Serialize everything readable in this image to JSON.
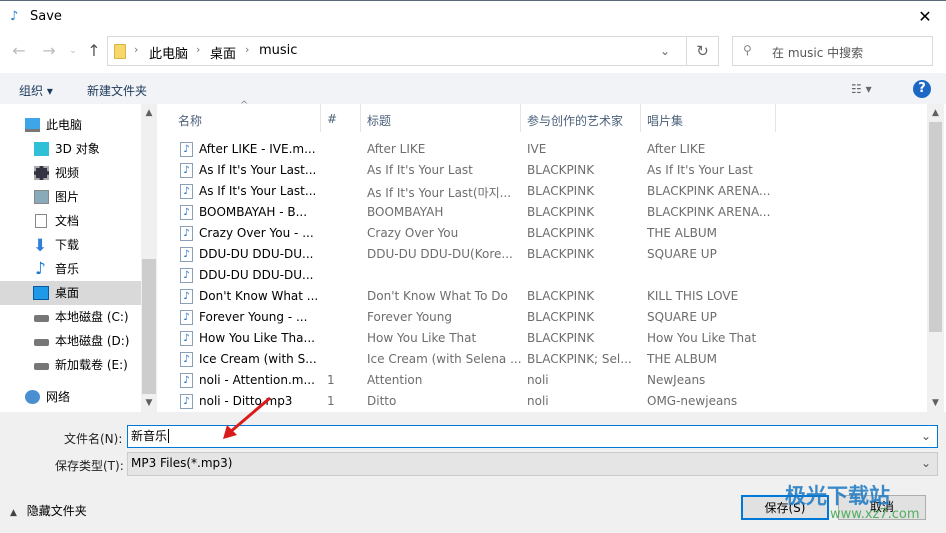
{
  "window": {
    "title": "Save",
    "close": "✕"
  },
  "address": {
    "crumbs": [
      "此电脑",
      "桌面",
      "music"
    ],
    "search_placeholder": "在 music 中搜索"
  },
  "toolbar": {
    "organize": "组织 ▾",
    "new_folder": "新建文件夹",
    "help": "?"
  },
  "sidebar": {
    "items": [
      {
        "label": "此电脑",
        "icon": "computer-icon"
      },
      {
        "label": "3D 对象",
        "icon": "cube-icon"
      },
      {
        "label": "视频",
        "icon": "video-icon"
      },
      {
        "label": "图片",
        "icon": "picture-icon"
      },
      {
        "label": "文档",
        "icon": "document-icon"
      },
      {
        "label": "下载",
        "icon": "download-icon"
      },
      {
        "label": "音乐",
        "icon": "music-icon"
      },
      {
        "label": "桌面",
        "icon": "desktop-icon",
        "selected": true
      },
      {
        "label": "本地磁盘 (C:)",
        "icon": "drive-icon"
      },
      {
        "label": "本地磁盘 (D:)",
        "icon": "drive-icon"
      },
      {
        "label": "新加载卷 (E:)",
        "icon": "drive-icon"
      },
      {
        "label": "网络",
        "icon": "network-icon"
      }
    ]
  },
  "columns": [
    "名称",
    "#",
    "标题",
    "参与创作的艺术家",
    "唱片集"
  ],
  "files": [
    {
      "name": "After LIKE - IVE.m...",
      "num": "",
      "title": "After LIKE",
      "artist": "IVE",
      "album": "After LIKE"
    },
    {
      "name": "As If It's Your Last...",
      "num": "",
      "title": "As If It's Your Last",
      "artist": "BLACKPINK",
      "album": "As If It's Your Last"
    },
    {
      "name": "As If It's Your Last...",
      "num": "",
      "title": "As If It's Your Last(마지...",
      "artist": "BLACKPINK",
      "album": "BLACKPINK ARENA..."
    },
    {
      "name": "BOOMBAYAH - B...",
      "num": "",
      "title": "BOOMBAYAH",
      "artist": "BLACKPINK",
      "album": "BLACKPINK ARENA..."
    },
    {
      "name": "Crazy Over You - ...",
      "num": "",
      "title": "Crazy Over You",
      "artist": "BLACKPINK",
      "album": "THE ALBUM"
    },
    {
      "name": "DDU-DU DDU-DU...",
      "num": "",
      "title": "DDU-DU DDU-DU(Kore...",
      "artist": "BLACKPINK",
      "album": "SQUARE UP"
    },
    {
      "name": "DDU-DU DDU-DU...",
      "num": "",
      "title": "",
      "artist": "",
      "album": ""
    },
    {
      "name": "Don't Know What ...",
      "num": "",
      "title": "Don't Know What To Do",
      "artist": "BLACKPINK",
      "album": "KILL THIS LOVE"
    },
    {
      "name": "Forever Young - ...",
      "num": "",
      "title": "Forever Young",
      "artist": "BLACKPINK",
      "album": "SQUARE UP"
    },
    {
      "name": "How You Like Tha...",
      "num": "",
      "title": "How You Like That",
      "artist": "BLACKPINK",
      "album": "How You Like That"
    },
    {
      "name": "Ice Cream (with S...",
      "num": "",
      "title": "Ice Cream (with Selena ...",
      "artist": "BLACKPINK; Sel...",
      "album": "THE ALBUM"
    },
    {
      "name": "noli - Attention.m...",
      "num": "1",
      "title": "Attention",
      "artist": "noli",
      "album": "NewJeans"
    },
    {
      "name": "noli - Ditto.mp3",
      "num": "1",
      "title": "Ditto",
      "artist": "noli",
      "album": "OMG-newjeans"
    }
  ],
  "form": {
    "filename_label": "文件名(N):",
    "filename_value": "新音乐",
    "type_label": "保存类型(T):",
    "type_value": "MP3 Files(*.mp3)"
  },
  "footer": {
    "hide_folders": "隐藏文件夹",
    "save": "保存(S)",
    "cancel": "取消"
  },
  "watermark": {
    "text": "极光下载站",
    "url": "www.xz7.com"
  },
  "colors": {
    "accent": "#0078d7",
    "selected": "#d9d9d9"
  }
}
